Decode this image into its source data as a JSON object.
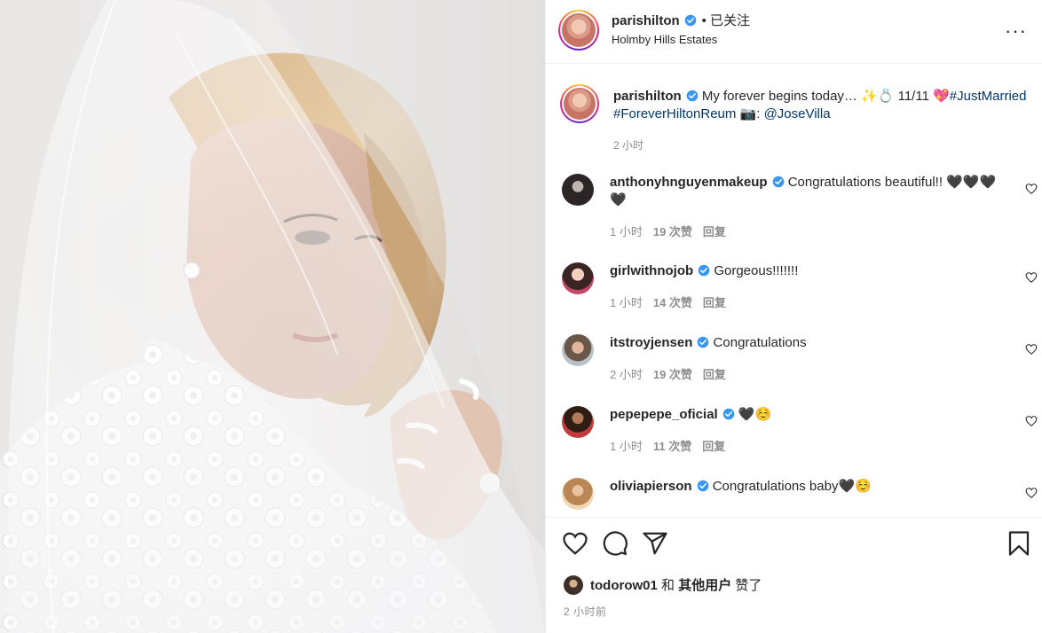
{
  "header": {
    "username": "parishilton",
    "follow_status": "已关注",
    "location": "Holmby Hills Estates",
    "more_icon": "more-horizontal-icon"
  },
  "caption": {
    "username": "parishilton",
    "text": "My forever begins today… ✨💍 11/11 💖",
    "hashtags": [
      "#JustMarried",
      "#ForeverHiltonReum"
    ],
    "credit_prefix": "📷: ",
    "mention": "@JoseVilla",
    "time": "2 小时"
  },
  "comments": [
    {
      "username": "anthonyhnguyenmakeup",
      "text": "Congratulations beautiful!! 🖤🖤🖤🖤",
      "time": "1 小时",
      "likes": "19 次赞",
      "reply": "回复"
    },
    {
      "username": "girlwithnojob",
      "text": "Gorgeous!!!!!!!",
      "time": "1 小时",
      "likes": "14 次赞",
      "reply": "回复"
    },
    {
      "username": "itstroyjensen",
      "text": "Congratulations",
      "time": "2 小时",
      "likes": "19 次赞",
      "reply": "回复"
    },
    {
      "username": "pepepepe_oficial",
      "text": "🖤☺️",
      "time": "1 小时",
      "likes": "11 次赞",
      "reply": "回复"
    },
    {
      "username": "oliviapierson",
      "text": "Congratulations baby🖤☺️",
      "time": "",
      "likes": "",
      "reply": ""
    }
  ],
  "actions": {
    "like_icon": "heart-outline-icon",
    "comment_icon": "comment-bubble-icon",
    "share_icon": "paper-plane-icon",
    "save_icon": "bookmark-icon"
  },
  "liked_by": {
    "first_user": "todorow01",
    "connector": " 和 ",
    "others": "其他用户",
    "suffix": " 赞了"
  },
  "post_age": "2 小时前",
  "colors": {
    "link": "#00376b",
    "verified": "#3897f0",
    "muted": "#8e8e8e"
  }
}
